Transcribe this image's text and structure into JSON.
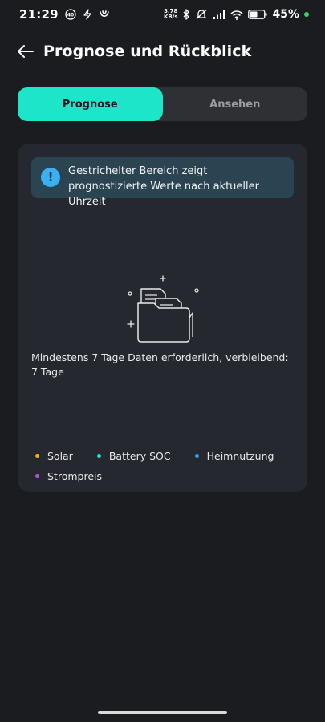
{
  "status_bar": {
    "time": "21:29",
    "net_speed_value": "3.78",
    "net_speed_unit": "KB/s",
    "battery_percent": "45%",
    "icons": [
      "notification-40-icon",
      "bolt-icon",
      "app-icon",
      "bluetooth-icon",
      "mute-icon",
      "signal-icon",
      "wifi-icon",
      "battery-icon",
      "charging-dot"
    ],
    "charge_color": "#3ad16a"
  },
  "header": {
    "back_icon": "arrow-left-icon",
    "title": "Prognose und Rückblick"
  },
  "tabs": [
    {
      "label": "Prognose",
      "active": true
    },
    {
      "label": "Ansehen",
      "active": false
    }
  ],
  "card": {
    "info": {
      "icon": "exclamation-icon",
      "text": "Gestrichelter Bereich zeigt prognostizierte Werte nach aktueller Uhrzeit"
    },
    "empty_state": {
      "icon": "empty-folder-icon",
      "message": "Mindestens 7 Tage Daten erforderlich, verbleibend: 7 Tage"
    },
    "legend": [
      {
        "label": "Solar",
        "color": "#f5b400"
      },
      {
        "label": "Battery SOC",
        "color": "#1de5c9"
      },
      {
        "label": "Heimnutzung",
        "color": "#2aa8f0"
      },
      {
        "label": "Strompreis",
        "color": "#a259e6"
      }
    ]
  },
  "colors": {
    "background": "#1b1c20",
    "card": "#26282f",
    "accent": "#1de5c9",
    "info_bg": "#2b4451",
    "info_icon": "#3bb0f0"
  }
}
